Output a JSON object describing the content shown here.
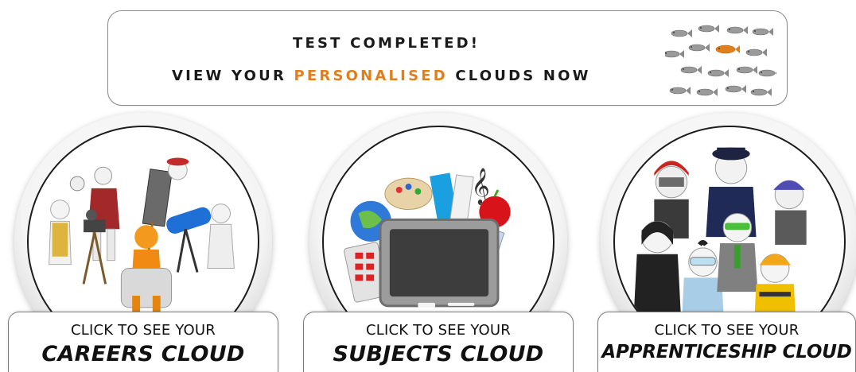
{
  "banner": {
    "line1": "TEST COMPLETED!",
    "line2_prefix": "VIEW YOUR",
    "line2_accent": "PERSONALISED",
    "line2_suffix": "CLOUDS NOW",
    "accent_color": "#e07f1c",
    "illustration": "school-of-grey-fish-with-one-gold-fish"
  },
  "cards": [
    {
      "id": "careers",
      "prompt": "CLICK TO SEE YOUR",
      "title": "CAREERS CLOUD",
      "illustration": "group-of-figures-doing-various-jobs"
    },
    {
      "id": "subjects",
      "prompt": "CLICK TO SEE YOUR",
      "title": "SUBJECTS CLOUD",
      "illustration": "chalkboard-with-school-supplies"
    },
    {
      "id": "apprenticeship",
      "prompt": "CLICK TO SEE YOUR",
      "title": "APPRENTICESHIP CLOUD",
      "illustration": "group-of-figures-in-work-uniforms"
    }
  ]
}
